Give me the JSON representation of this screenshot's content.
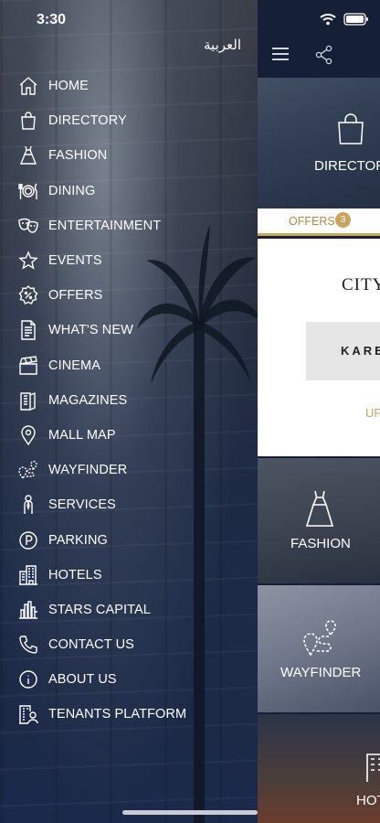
{
  "status_bar": {
    "time": "3:30"
  },
  "drawer": {
    "language_toggle": "العربية",
    "items": [
      {
        "label": "HOME",
        "icon": "home-icon"
      },
      {
        "label": "DIRECTORY",
        "icon": "shopping-bag-icon"
      },
      {
        "label": "FASHION",
        "icon": "dress-icon"
      },
      {
        "label": "DINING",
        "icon": "plate-cutlery-icon"
      },
      {
        "label": "ENTERTAINMENT",
        "icon": "theatre-masks-icon"
      },
      {
        "label": "EVENTS",
        "icon": "star-icon"
      },
      {
        "label": "OFFERS",
        "icon": "discount-badge-icon"
      },
      {
        "label": "WHAT'S NEW",
        "icon": "document-icon"
      },
      {
        "label": "CINEMA",
        "icon": "clapperboard-icon"
      },
      {
        "label": "MAGAZINES",
        "icon": "magazine-icon"
      },
      {
        "label": "MALL MAP",
        "icon": "map-pin-icon"
      },
      {
        "label": "WAYFINDER",
        "icon": "route-icon"
      },
      {
        "label": "SERVICES",
        "icon": "person-icon"
      },
      {
        "label": "PARKING",
        "icon": "parking-icon"
      },
      {
        "label": "HOTELS",
        "icon": "hotel-building-icon"
      },
      {
        "label": "STARS CAPITAL",
        "icon": "skyline-icon"
      },
      {
        "label": "CONTACT US",
        "icon": "phone-icon"
      },
      {
        "label": "ABOUT US",
        "icon": "info-icon"
      },
      {
        "label": "TENANTS PLATFORM",
        "icon": "tenants-icon"
      }
    ]
  },
  "main": {
    "directory_tile": {
      "label": "DIRECTORY"
    },
    "offers_bar": {
      "label": "OFFERS",
      "count": "3"
    },
    "promo": {
      "brand": "CITY",
      "button_text": "KAREN",
      "link_text": "UP"
    },
    "tiles": [
      {
        "label": "FASHION"
      },
      {
        "label": "WAYFINDER"
      },
      {
        "label": "HOTE"
      }
    ]
  },
  "colors": {
    "accent_gold": "#c9a45a",
    "drawer_navy": "#1b2a4a"
  }
}
